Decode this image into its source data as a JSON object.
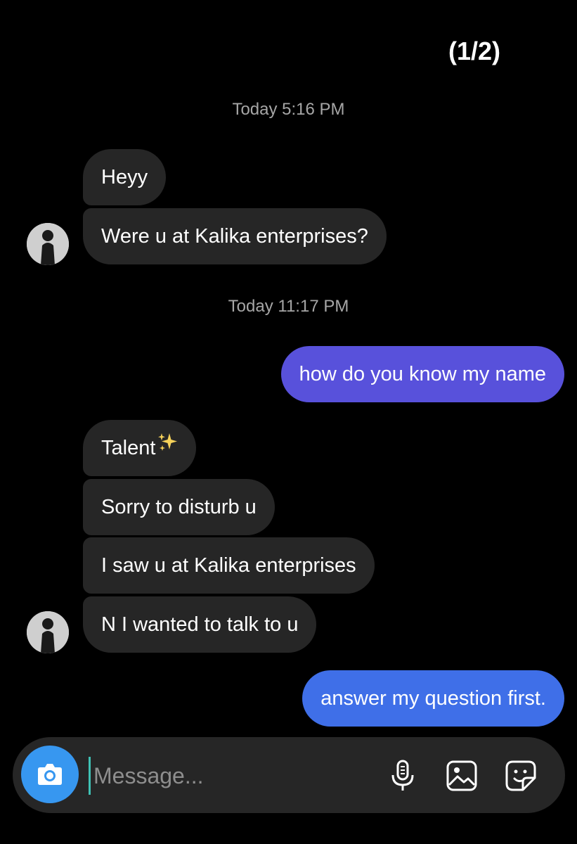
{
  "header": {
    "page_counter": "(1/2)"
  },
  "thread": {
    "timestamps": [
      "Today 5:16 PM",
      "Today 11:17 PM"
    ],
    "messages": [
      {
        "sender": "them",
        "text": "Heyy"
      },
      {
        "sender": "them",
        "text": "Were u at Kalika enterprises?"
      },
      {
        "sender": "me",
        "text": "how do you know my name"
      },
      {
        "sender": "them",
        "text": "Talent",
        "emoji": "sparkles-icon"
      },
      {
        "sender": "them",
        "text": "Sorry to disturb u"
      },
      {
        "sender": "them",
        "text": "I saw u at Kalika enterprises"
      },
      {
        "sender": "them",
        "text": "N I wanted to talk to u"
      },
      {
        "sender": "me",
        "text": "answer my question first."
      }
    ]
  },
  "composer": {
    "placeholder": "Message...",
    "icons": [
      "camera-icon",
      "microphone-icon",
      "gallery-icon",
      "sticker-icon"
    ]
  },
  "colors": {
    "background": "#000000",
    "incoming_bubble": "#262626",
    "outgoing_bubble_1": "#5851db",
    "outgoing_bubble_2": "#3f6fe8",
    "accent_blue": "#3797f0",
    "timestamp_text": "#a6a6a6"
  }
}
